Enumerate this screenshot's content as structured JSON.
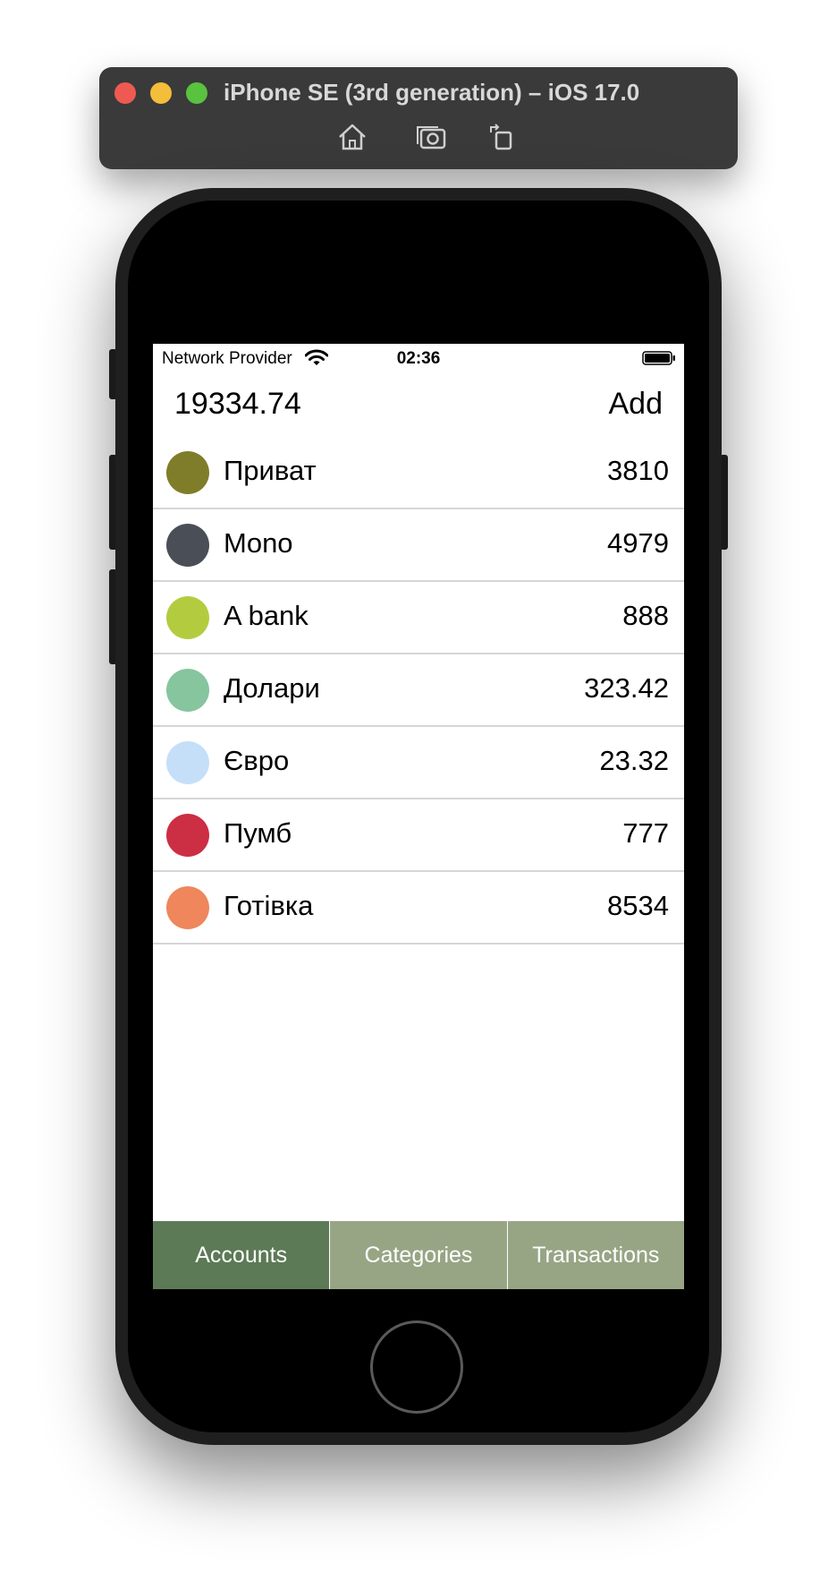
{
  "simulator": {
    "title": "iPhone SE (3rd generation) – iOS 17.0",
    "icons": [
      "home-icon",
      "screenshot-icon",
      "rotate-icon"
    ]
  },
  "status_bar": {
    "carrier": "Network Provider",
    "time": "02:36"
  },
  "header": {
    "total": "19334.74",
    "add_label": "Add"
  },
  "accounts": [
    {
      "name": "Приват",
      "amount": "3810",
      "color": "#807d2a"
    },
    {
      "name": "Mono",
      "amount": "4979",
      "color": "#4a4f57"
    },
    {
      "name": "A bank",
      "amount": "888",
      "color": "#b3cc3f"
    },
    {
      "name": "Долари",
      "amount": "323.42",
      "color": "#86c59e"
    },
    {
      "name": "Євро",
      "amount": "23.32",
      "color": "#c5dff9"
    },
    {
      "name": "Пумб",
      "amount": "777",
      "color": "#cc2e44"
    },
    {
      "name": "Готівка",
      "amount": "8534",
      "color": "#ef865c"
    }
  ],
  "tabs": [
    {
      "label": "Accounts",
      "active": true
    },
    {
      "label": "Categories",
      "active": false
    },
    {
      "label": "Transactions",
      "active": false
    }
  ],
  "colors": {
    "tab_active": "#5c7a56",
    "tab_inactive": "#97a585"
  }
}
